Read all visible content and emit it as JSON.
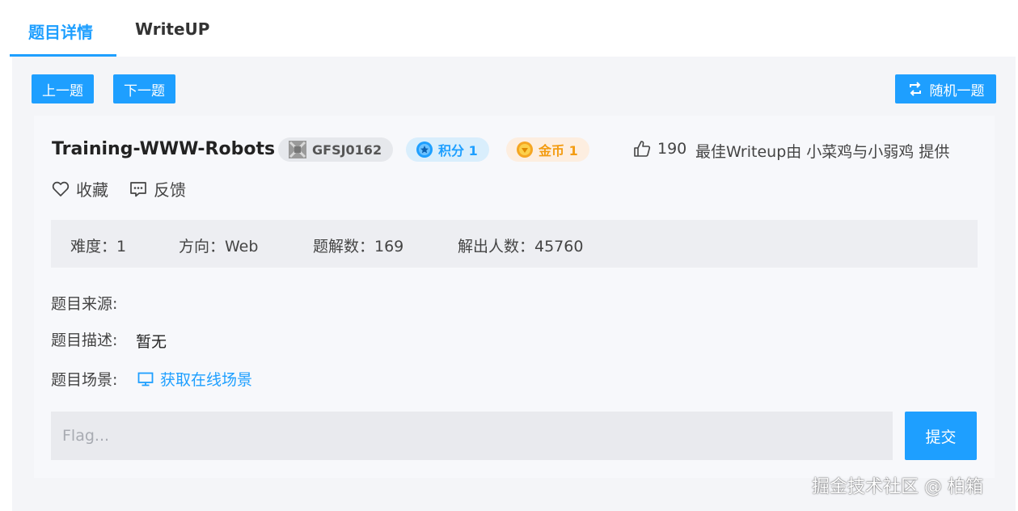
{
  "tabs": [
    {
      "label": "题目详情",
      "active": true
    },
    {
      "label": "WriteUP",
      "active": false
    }
  ],
  "toolbar": {
    "prev_label": "上一题",
    "next_label": "下一题",
    "random_label": "随机一题",
    "random_icon": "swap-arrows-icon"
  },
  "challenge": {
    "title": "Training-WWW-Robots",
    "code": "GFSJ0162",
    "points_label": "积分 1",
    "coins_label": "金币 1",
    "likes": "190",
    "best_writeup": "最佳Writeup由 小菜鸡与小弱鸡 提供",
    "favorite_label": "收藏",
    "feedback_label": "反馈"
  },
  "stats": {
    "difficulty": "难度：1",
    "direction": "方向：Web",
    "solves": "题解数：169",
    "solvers": "解出人数：45760"
  },
  "details": {
    "source_label": "题目来源:",
    "source_value": "",
    "description_label": "题目描述:",
    "description_value": "暂无",
    "scene_label": "题目场景:",
    "scene_link": "获取在线场景"
  },
  "flag": {
    "placeholder": "Flag...",
    "value": "",
    "submit_label": "提交"
  },
  "watermark": "掘金技术社区 @ 柏箱",
  "colors": {
    "accent": "#1e9fff",
    "points_badge_bg": "#d9eefc",
    "coins_badge_bg": "#fdeee0",
    "code_badge_bg": "#e6e8ec"
  }
}
